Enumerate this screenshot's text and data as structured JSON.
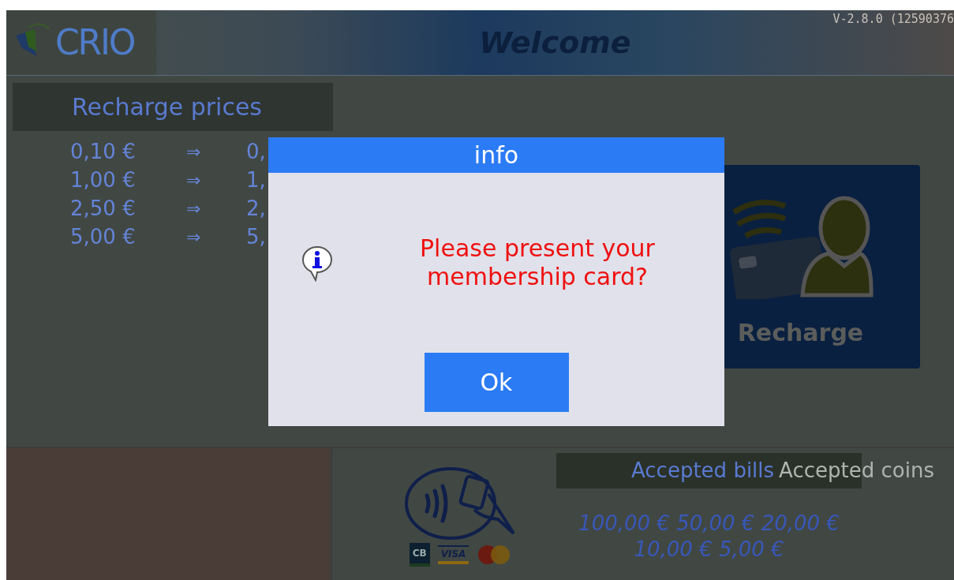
{
  "header": {
    "logo": "CRIO",
    "title": "Welcome",
    "version": "V-2.8.0 (12590376"
  },
  "prices": {
    "title": "Recharge prices",
    "rows": [
      {
        "amount": "0,10 €",
        "arrow": "⇒",
        "credit": "0,"
      },
      {
        "amount": "1,00 €",
        "arrow": "⇒",
        "credit": "1,"
      },
      {
        "amount": "2,50 €",
        "arrow": "⇒",
        "credit": "2,"
      },
      {
        "amount": "5,00 €",
        "arrow": "⇒",
        "credit": "5,"
      }
    ]
  },
  "recharge": {
    "label": "Recharge"
  },
  "payment": {
    "card_logos": [
      "CB",
      "VISA"
    ],
    "bills_title": "Accepted bills",
    "coins_title": "Accepted coins",
    "bills": "100,00 € 50,00 € 20,00 € 10,00 € 5,00 €"
  },
  "dialog": {
    "title": "info",
    "message": "Please present your membership card?",
    "button": "Ok"
  }
}
